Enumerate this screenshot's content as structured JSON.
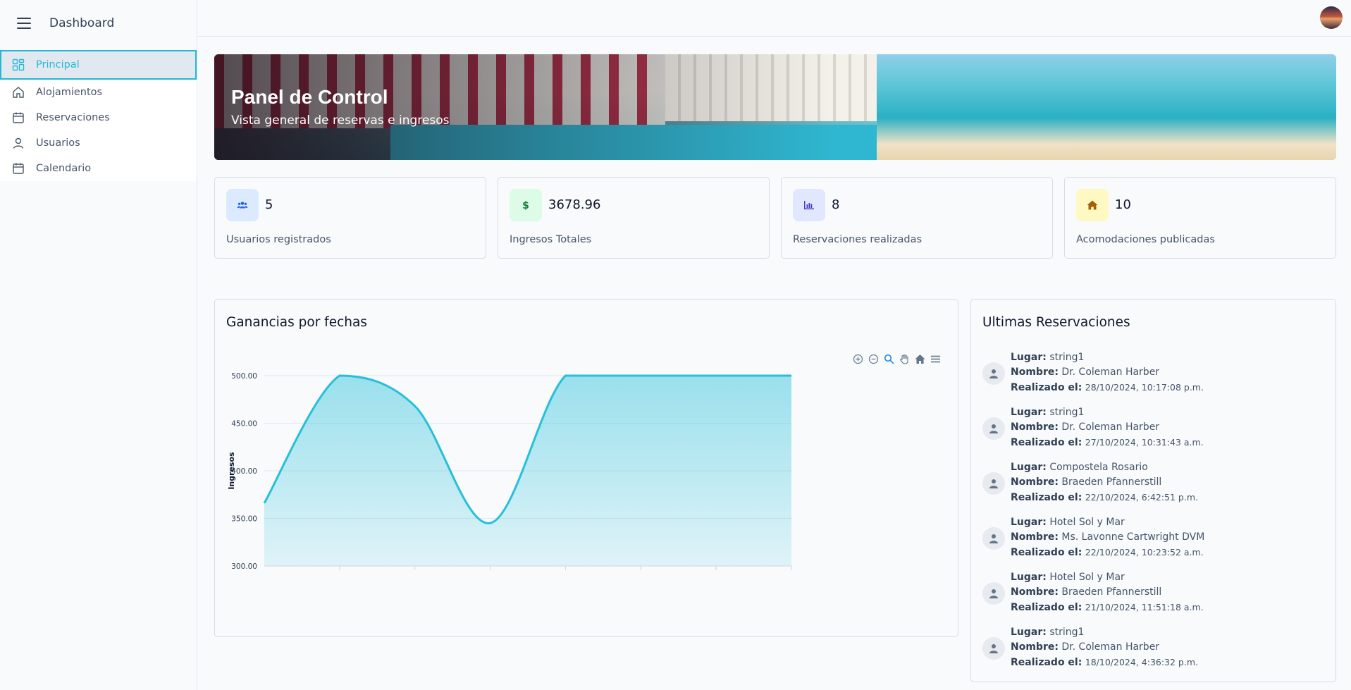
{
  "sidebar": {
    "title": "Dashboard",
    "items": [
      {
        "label": "Principal",
        "icon": "grid-icon"
      },
      {
        "label": "Alojamientos",
        "icon": "home-icon"
      },
      {
        "label": "Reservaciones",
        "icon": "calendar-icon"
      },
      {
        "label": "Usuarios",
        "icon": "user-icon"
      },
      {
        "label": "Calendario",
        "icon": "calendar-icon"
      }
    ]
  },
  "banner": {
    "title": "Panel de Control",
    "subtitle": "Vista general de reservas e ingresos"
  },
  "stats": [
    {
      "value": "5",
      "label": "Usuarios registrados",
      "icon": "users-icon",
      "bg": "#dbeafe",
      "fg": "#2563eb"
    },
    {
      "value": "3678.96",
      "label": "Ingresos Totales",
      "icon": "dollar-icon",
      "bg": "#dcfce7",
      "fg": "#15803d"
    },
    {
      "value": "8",
      "label": "Reservaciones realizadas",
      "icon": "bar-chart-icon",
      "bg": "#e0e7ff",
      "fg": "#4338ca"
    },
    {
      "value": "10",
      "label": "Acomodaciones publicadas",
      "icon": "house-icon",
      "bg": "#fef9c3",
      "fg": "#a16207"
    }
  ],
  "chart_card": {
    "title": "Ganancias por fechas"
  },
  "chart_data": {
    "type": "area",
    "title": "Ganancias por fechas",
    "xlabel": "",
    "ylabel": "Ingresos",
    "ylim": [
      300,
      500
    ],
    "yticks": [
      "500.00",
      "450.00",
      "400.00",
      "350.00",
      "300.00"
    ],
    "series": [
      {
        "values": [
          366,
          500,
          468,
          345,
          500,
          500,
          500,
          500
        ]
      }
    ],
    "grid": true,
    "color": "#26c0d9"
  },
  "reservations": {
    "title": "Ultimas Reservaciones",
    "labels": {
      "place": "Lugar:",
      "name": "Nombre:",
      "date": "Realizado el:"
    },
    "items": [
      {
        "place": "string1",
        "name": "Dr. Coleman Harber",
        "date": "28/10/2024, 10:17:08 p.m."
      },
      {
        "place": "string1",
        "name": "Dr. Coleman Harber",
        "date": "27/10/2024, 10:31:43 a.m."
      },
      {
        "place": "Compostela Rosario",
        "name": "Braeden Pfannerstill",
        "date": "22/10/2024, 6:42:51 p.m."
      },
      {
        "place": "Hotel Sol y Mar",
        "name": "Ms. Lavonne Cartwright DVM",
        "date": "22/10/2024, 10:23:52 a.m."
      },
      {
        "place": "Hotel Sol y Mar",
        "name": "Braeden Pfannerstill",
        "date": "21/10/2024, 11:51:18 a.m."
      },
      {
        "place": "string1",
        "name": "Dr. Coleman Harber",
        "date": "18/10/2024, 4:36:32 p.m."
      }
    ]
  }
}
